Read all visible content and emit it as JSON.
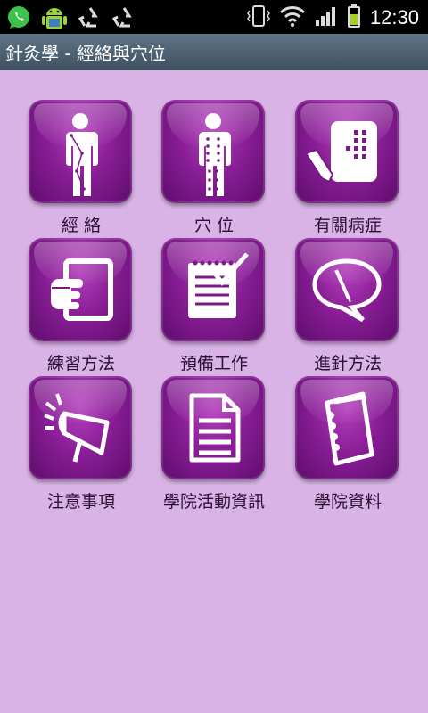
{
  "status_bar": {
    "time": "12:30",
    "notification_icons": [
      "whatsapp-icon",
      "android-icon",
      "recycle-icon",
      "recycle-icon"
    ],
    "system_icons": [
      "vibrate-icon",
      "wifi-icon",
      "signal-icon",
      "battery-icon"
    ]
  },
  "header": {
    "title": "針灸學 - 經絡與穴位"
  },
  "menu": {
    "items": [
      {
        "label": "經 絡",
        "icon": "meridian-body-icon"
      },
      {
        "label": "穴 位",
        "icon": "acupoint-body-icon"
      },
      {
        "label": "有關病症",
        "icon": "note-writing-icon"
      },
      {
        "label": "練習方法",
        "icon": "pointing-hand-icon"
      },
      {
        "label": "預備工作",
        "icon": "checklist-notepad-icon"
      },
      {
        "label": "進針方法",
        "icon": "needle-speech-icon"
      },
      {
        "label": "注意事項",
        "icon": "megaphone-icon"
      },
      {
        "label": "學院活動資訊",
        "icon": "document-icon"
      },
      {
        "label": "學院資料",
        "icon": "notebook-icon"
      }
    ]
  },
  "colors": {
    "background": "#d9b3e6",
    "tile": "#8a1e97",
    "title_bar": "#4f6475"
  }
}
